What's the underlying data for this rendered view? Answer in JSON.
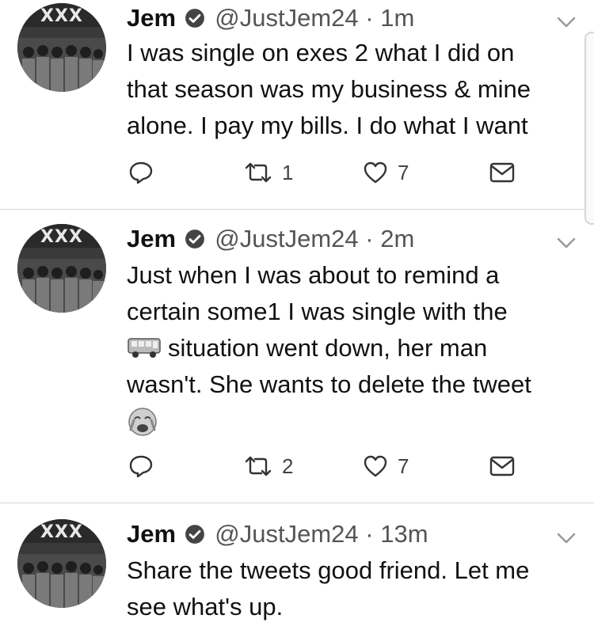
{
  "tweets": [
    {
      "name": "Jem",
      "handle": "@JustJem24",
      "time": "1m",
      "avatar_banner": "XXX",
      "lines": [
        "I was single on exes 2 what I did on",
        "that season was my business & mine",
        "alone. I pay my bills. I do what I want"
      ],
      "retweets": "1",
      "likes": "7"
    },
    {
      "name": "Jem",
      "handle": "@JustJem24",
      "time": "2m",
      "avatar_banner": "XXX",
      "lines": [
        "Just when I was about to remind a",
        "certain some1 I was single with the",
        "situation went down, her man",
        "wasn't. She wants to delete the tweet"
      ],
      "inline_emoji": "bus-icon",
      "trailing_emoji": "crying-face-emoji",
      "retweets": "2",
      "likes": "7"
    },
    {
      "name": "Jem",
      "handle": "@JustJem24",
      "time": "13m",
      "avatar_banner": "XXX",
      "lines": [
        "Share the tweets good friend. Let me",
        "see what's up."
      ]
    }
  ],
  "separator": "·",
  "colors": {
    "text": "#111111",
    "secondary": "#555555",
    "divider": "#d4d4d4"
  }
}
